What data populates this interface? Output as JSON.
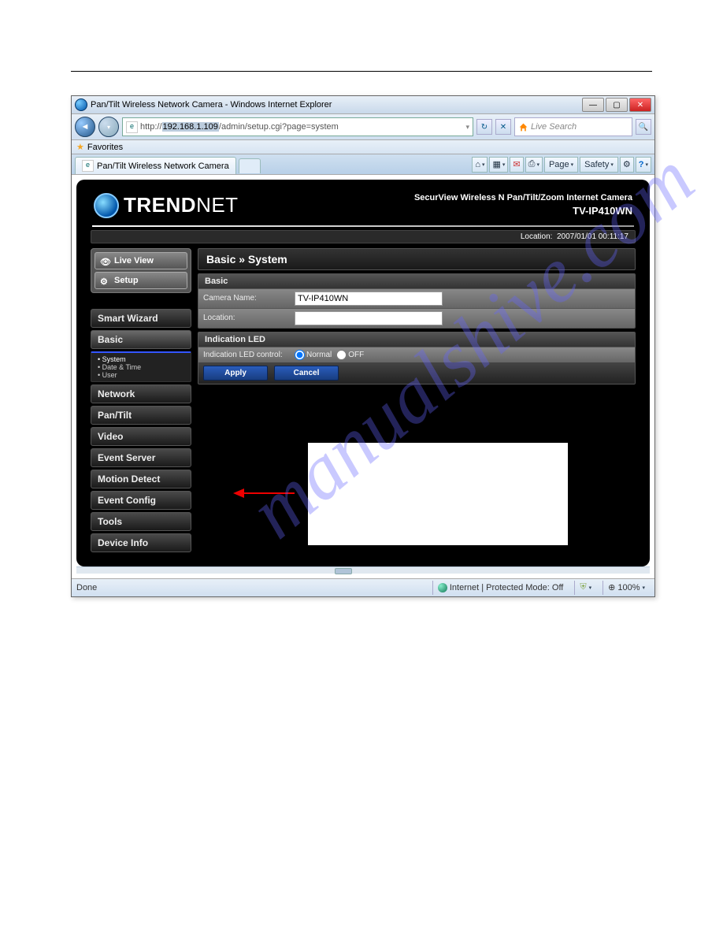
{
  "watermark": "manualshive.com",
  "window": {
    "title": "Pan/Tilt Wireless Network Camera - Windows Internet Explorer",
    "min": "—",
    "max": "▢",
    "close": "✕"
  },
  "nav": {
    "back": "◄",
    "fwd": "▾",
    "url_prefix": "http://",
    "url_ip": "192.168.1.109",
    "url_rest": "/admin/setup.cgi?page=system",
    "refresh": "↻",
    "stop": "✕"
  },
  "search": {
    "placeholder": "Live Search",
    "go": "🔍"
  },
  "favorites_label": "Favorites",
  "tab": {
    "title": "Pan/Tilt Wireless Network Camera"
  },
  "toolbar": {
    "home": "⌂",
    "feeds": "▦",
    "mail": "✉",
    "print": "⎙",
    "page": "Page",
    "safety": "Safety",
    "tools": "⚙",
    "help": "?"
  },
  "brand": {
    "trend": "TREND",
    "net": "NET"
  },
  "header": {
    "productname": "SecurView Wireless N Pan/Tilt/Zoom Internet Camera",
    "model": "TV-IP410WN",
    "location_label": "Location:",
    "location_value": "2007/01/01 00:11:17"
  },
  "left": {
    "liveview": "Live View",
    "setup": "Setup",
    "items": [
      "Smart Wizard",
      "Basic",
      "Network",
      "Pan/Tilt",
      "Video",
      "Event Server",
      "Motion Detect",
      "Event Config",
      "Tools",
      "Device Info"
    ],
    "basic_sub": {
      "system": "System",
      "datetime": "Date & Time",
      "user": "User"
    }
  },
  "main": {
    "breadcrumb": "Basic » System",
    "basic_hdr": "Basic",
    "camera_name_label": "Camera Name:",
    "camera_name_value": "TV-IP410WN",
    "location_label": "Location:",
    "location_value": "",
    "led_hdr": "Indication LED",
    "led_label": "Indication LED control:",
    "led_normal": "Normal",
    "led_off": "OFF",
    "apply": "Apply",
    "cancel": "Cancel"
  },
  "status": {
    "done": "Done",
    "protected": "Internet | Protected Mode: Off",
    "zoom": "100%",
    "zoom_icon": "⊕"
  }
}
